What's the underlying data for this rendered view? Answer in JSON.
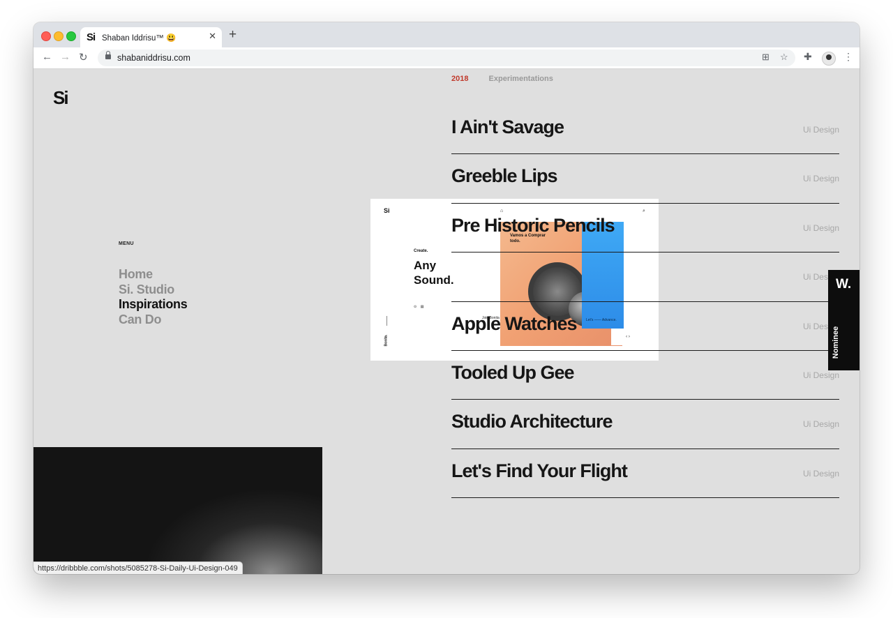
{
  "browser": {
    "tab_title": "Shaban Iddrisu™ 😃",
    "tab_favicon": "Si",
    "url": "shabaniddrisu.com",
    "status_url": "https://dribbble.com/shots/5085278-Si-Daily-Ui-Design-049"
  },
  "site": {
    "logo": "Si",
    "menu_label": "MENU",
    "menu_items": [
      {
        "label": "Home",
        "active": false
      },
      {
        "label": "Si. Studio",
        "active": false
      },
      {
        "label": "Inspirations",
        "active": true
      },
      {
        "label": "Can Do",
        "active": false
      }
    ],
    "tabs": {
      "year": "2018",
      "experiments": "Experimentations"
    },
    "projects": [
      {
        "title": "I Ain't Savage",
        "category": "Ui Design"
      },
      {
        "title": "Greeble Lips",
        "category": "Ui Design"
      },
      {
        "title": "Pre Historic Pencils",
        "category": "Ui Design"
      },
      {
        "title": "",
        "category": "Ui Design"
      },
      {
        "title": "Apple Watches",
        "category": "Ui Design"
      },
      {
        "title": "Tooled Up Gee",
        "category": "Ui Design"
      },
      {
        "title": "Studio Architecture",
        "category": "Ui Design"
      },
      {
        "title": "Let's Find Your Flight",
        "category": "Ui Design"
      }
    ],
    "preview": {
      "logo": "Si",
      "create": "Create.",
      "headline": "Any Sound.",
      "caption": "Vamos a Comprar todo.",
      "small_text": "Join Bonita is Your Hub",
      "vertical_label": "Bonita.",
      "cta": "Let's —— Advance.",
      "nav": "‹ ›"
    },
    "nominee": {
      "badge": "W.",
      "label": "Nominee"
    }
  },
  "colors": {
    "accent": "#c0392b",
    "background": "#dfdfdf",
    "text": "#161616"
  }
}
